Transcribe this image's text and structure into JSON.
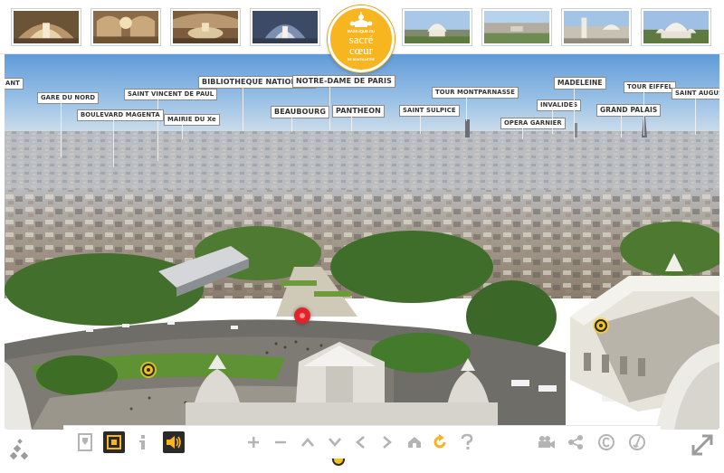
{
  "logo": {
    "line1": "BASILIQUE DU",
    "line2": "sacré",
    "line3": "cœur",
    "line4": "DE MONTMARTRE"
  },
  "thumbnails": [
    {
      "name": "thumb-nave-interior"
    },
    {
      "name": "thumb-choir-interior"
    },
    {
      "name": "thumb-altar-interior"
    },
    {
      "name": "thumb-apse-interior"
    },
    {
      "name": "thumb-basilica-exterior"
    },
    {
      "name": "thumb-paris-panorama"
    },
    {
      "name": "thumb-basilica-terrace"
    },
    {
      "name": "thumb-basilica-facade"
    }
  ],
  "landmarks": [
    {
      "id": "ant",
      "label": "ANT"
    },
    {
      "id": "gare-du-nord",
      "label": "GARE DU NORD"
    },
    {
      "id": "saint-vincent-de-paul",
      "label": "SAINT VINCENT DE PAUL"
    },
    {
      "id": "boulevard-magenta",
      "label": "BOULEVARD MAGENTA"
    },
    {
      "id": "mairie-du-xe",
      "label": "MAIRIE DU Xe"
    },
    {
      "id": "bibliotheque-nationale",
      "label": "BIBLIOTHEQUE NATIONALE"
    },
    {
      "id": "notre-dame-de-paris",
      "label": "NOTRE-DAME DE PARIS"
    },
    {
      "id": "beaubourg",
      "label": "BEAUBOURG"
    },
    {
      "id": "pantheon",
      "label": "PANTHEON"
    },
    {
      "id": "saint-sulpice",
      "label": "SAINT SULPICE"
    },
    {
      "id": "tour-montparnasse",
      "label": "TOUR MONTPARNASSE"
    },
    {
      "id": "opera-garnier",
      "label": "OPERA GARNIER"
    },
    {
      "id": "invalides",
      "label": "INVALIDES"
    },
    {
      "id": "madeleine",
      "label": "MADELEINE"
    },
    {
      "id": "grand-palais",
      "label": "GRAND PALAIS"
    },
    {
      "id": "tour-eiffel",
      "label": "TOUR EIFFEL"
    },
    {
      "id": "saint-augustin",
      "label": "SAINT AUGUSTIN"
    }
  ],
  "toolbar": {
    "buttons": [
      {
        "icon": "map-pin-icon",
        "state": "off"
      },
      {
        "icon": "fullscreen-icon",
        "state": "on"
      },
      {
        "icon": "info-icon",
        "state": "off"
      },
      {
        "icon": "sound-icon",
        "state": "on"
      },
      {
        "icon": "zoom-in-icon",
        "state": "off"
      },
      {
        "icon": "zoom-out-icon",
        "state": "off"
      },
      {
        "icon": "arrow-up-icon",
        "state": "off"
      },
      {
        "icon": "arrow-down-icon",
        "state": "off"
      },
      {
        "icon": "arrow-left-icon",
        "state": "off"
      },
      {
        "icon": "arrow-right-icon",
        "state": "off"
      },
      {
        "icon": "home-icon",
        "state": "off"
      },
      {
        "icon": "autorotate-icon",
        "state": "off"
      },
      {
        "icon": "help-icon",
        "state": "off"
      },
      {
        "icon": "video-camera-icon",
        "state": "off"
      },
      {
        "icon": "share-icon",
        "state": "off"
      },
      {
        "icon": "copyright-icon",
        "state": "off"
      },
      {
        "icon": "credits-icon",
        "state": "off"
      }
    ]
  },
  "colors": {
    "accent": "#f7b51f",
    "toggle_on_bg": "#2a2a2a",
    "icon_gray": "#b4b4b4",
    "icon_dark": "#444444",
    "red_hotspot": "#e2232a"
  },
  "corners": {
    "left_icon": "diamonds-menu-icon",
    "right_icon": "expand-arrows-icon"
  }
}
